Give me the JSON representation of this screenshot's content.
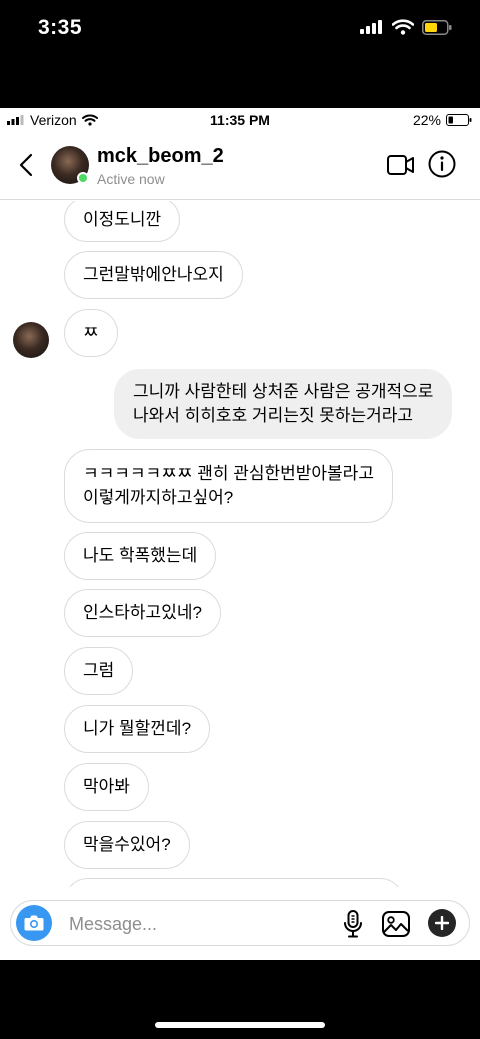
{
  "device_status": {
    "time": "3:35"
  },
  "inner_status": {
    "carrier": "Verizon",
    "time": "11:35 PM",
    "battery": "22%"
  },
  "chat_header": {
    "username": "mck_beom_2",
    "status": "Active now"
  },
  "messages": [
    {
      "text": "이정도니깐",
      "side": "received"
    },
    {
      "text": "그런말밖에안나오지",
      "side": "received"
    },
    {
      "text": "ㅉ",
      "side": "received"
    },
    {
      "lines": [
        "그니까 사람한테 상처준 사람은 공개적으로",
        "나와서 히히호호 거리는짓 못하는거라고"
      ],
      "side": "sent"
    },
    {
      "lines": [
        "ㅋㅋㅋㅋㅋㅉㅉ 괜히 관심한번받아볼라고",
        "이렇게까지하고싶어?"
      ],
      "side": "received"
    },
    {
      "text": "나도 학폭했는데",
      "side": "received"
    },
    {
      "text": "인스타하고있네?",
      "side": "received"
    },
    {
      "text": "그럼",
      "side": "received"
    },
    {
      "text": "니가 뭘할껀데?",
      "side": "received"
    },
    {
      "text": "막아봐",
      "side": "received"
    },
    {
      "text": "막을수있어?",
      "side": "received"
    }
  ],
  "composer": {
    "placeholder": "Message..."
  },
  "icons": {
    "back": "chevron-left-icon",
    "video": "video-camera-icon",
    "info": "info-icon",
    "camera": "camera-icon",
    "mic": "microphone-icon",
    "gallery": "image-icon",
    "plus": "plus-icon"
  },
  "colors": {
    "accent": "#3897f0",
    "online": "#4cd964",
    "sent_bubble": "#efefef"
  }
}
